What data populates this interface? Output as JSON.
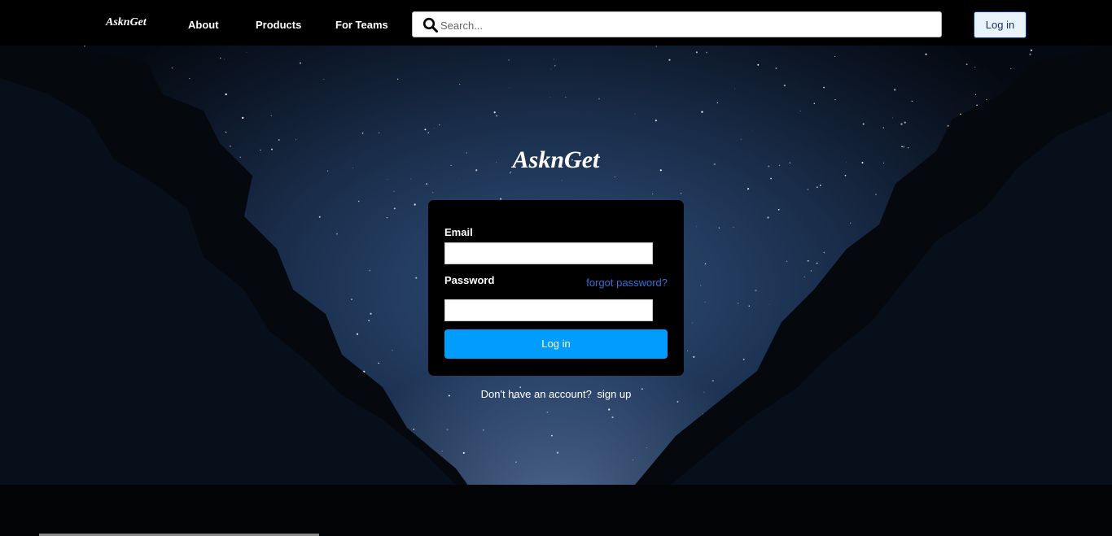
{
  "navbar": {
    "brand": "AsknGet",
    "links": [
      "About",
      "Products",
      "For Teams"
    ],
    "search_placeholder": "Search...",
    "login_label": "Log in"
  },
  "main": {
    "brand": "AsknGet",
    "email_label": "Email",
    "password_label": "Password",
    "forgot_label": "forgot password?",
    "login_button": "Log in",
    "signup_prompt": "Don't have an account?",
    "signup_link": "sign up"
  },
  "colors": {
    "navbar_bg": "#000000",
    "card_bg": "#000000",
    "primary_button": "#009dff",
    "link": "#2f6fd6"
  },
  "icons": {
    "search": "search-icon"
  }
}
